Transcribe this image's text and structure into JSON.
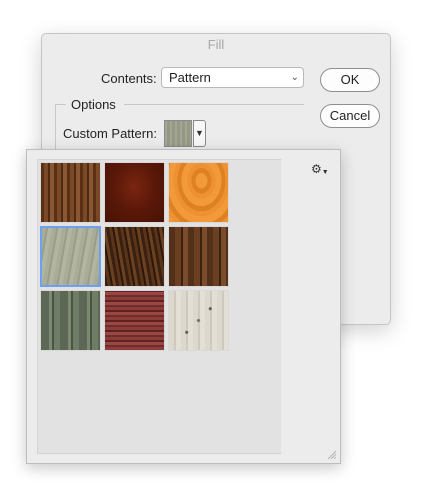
{
  "dialog": {
    "title": "Fill",
    "contents_label": "Contents:",
    "contents_value": "Pattern",
    "ok_label": "OK",
    "cancel_label": "Cancel",
    "options_label": "Options",
    "custom_pattern_label": "Custom Pattern:"
  },
  "pattern_picker": {
    "tiles": [
      {
        "name": "wood-brown-vertical"
      },
      {
        "name": "wood-red-mahogany"
      },
      {
        "name": "wood-orange-light"
      },
      {
        "name": "wood-grey-green",
        "selected": true
      },
      {
        "name": "wood-dark-walnut"
      },
      {
        "name": "wood-planks-brown"
      },
      {
        "name": "wood-green-planks"
      },
      {
        "name": "fabric-red-stripes"
      },
      {
        "name": "birch-bark-white"
      }
    ]
  },
  "colors": {
    "dialog_bg": "#ececec",
    "selection": "#6ea0f0"
  }
}
